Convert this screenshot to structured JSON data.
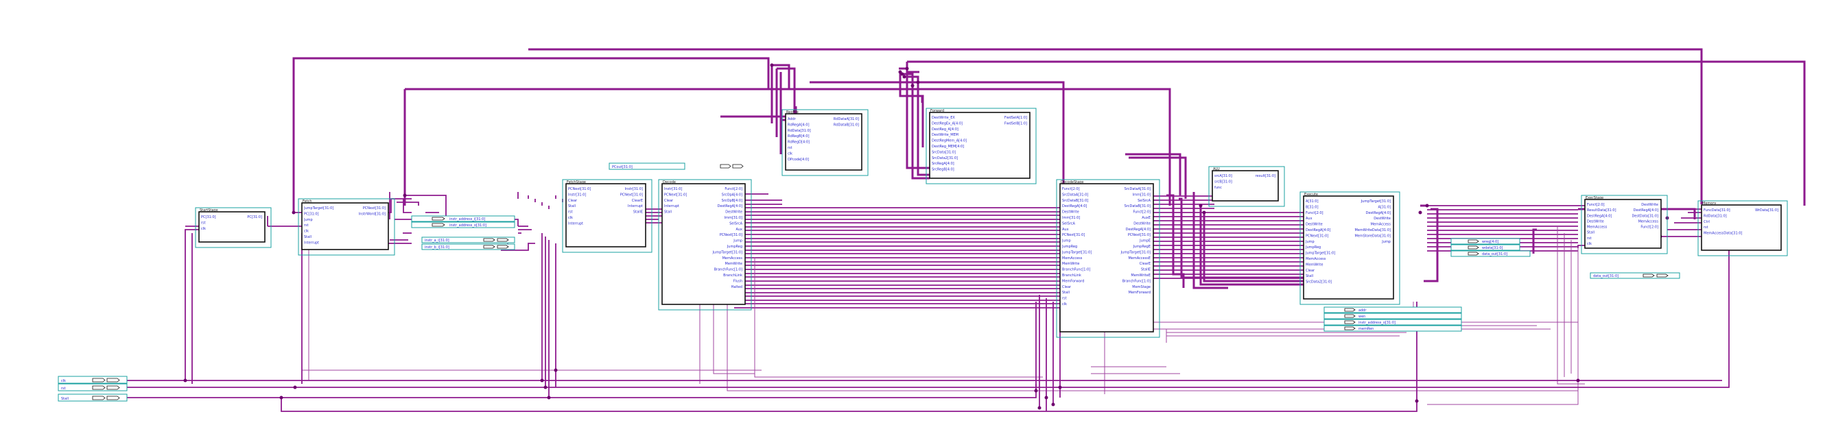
{
  "colors": {
    "wire": "#8e1a8e",
    "box_frame": "#1aa0a0",
    "port_text": "#2a2ad0"
  },
  "modules": [
    {
      "id": "start",
      "title": "StartStage",
      "inputs": [
        "PC[31:0]",
        "rst",
        "clk"
      ],
      "outputs": [
        "PC[31:0]"
      ]
    },
    {
      "id": "fetch",
      "title": "Fetch",
      "inputs": [
        "JumpTarget[31:0]",
        "PC[31:0]",
        "Jump",
        "rst",
        "clk",
        "Stall",
        "Interrupt"
      ],
      "outputs": [
        "PCNext[31:0]",
        "InstrWord[31:0]"
      ]
    },
    {
      "id": "fetchstage",
      "title": "FetchStage",
      "inputs": [
        "PCNext[31:0]",
        "Instr[31:0]",
        "Clear",
        "Stall",
        "rst",
        "clk",
        "Interrupt"
      ],
      "outputs": [
        "Instr[31:0]",
        "PCNext[31:0]",
        "ClearE",
        "Interrupt",
        "StallE"
      ]
    },
    {
      "id": "decode",
      "title": "Decode",
      "inputs": [
        "Instr[31:0]",
        "PCNext[31:0]",
        "Clear",
        "Interrupt",
        "Stall"
      ],
      "outputs": [
        "Funct[2:0]",
        "SrcOpA[4:0]",
        "SrcOpB[4:0]",
        "DestRegA[4:0]",
        "DestWrite",
        "Imm[31:0]",
        "SelSrcA",
        "Aux",
        "PCNext[31:0]",
        "Jump",
        "JumpReg",
        "JumpTarget[31:0]",
        "MemAccess",
        "MemWrite",
        "BranchFunc[1:0]",
        "BranchLink",
        "Flush",
        "Halted"
      ]
    },
    {
      "id": "regfile",
      "title": "RegFile",
      "inputs": [
        "Addr",
        "RdRegA[4:0]",
        "RdData[31:0]",
        "RdRegB[4:0]",
        "RdRegD[4:0]",
        "rst",
        "clk",
        "OPcode[4:0]"
      ],
      "outputs": [
        "RdDataA[31:0]",
        "RdDataB[31:0]"
      ]
    },
    {
      "id": "forward",
      "title": "Forward",
      "inputs": [
        "DestWrite_EX",
        "DestRegEx_A[4:0]",
        "DestReg_A[4:0]",
        "DestWrite_MEM",
        "DestRegMem_A[4:0]",
        "DestReg_MEM[4:0]",
        "SrcData[31:0]",
        "SrcData2[31:0]",
        "SrcRegA[4:0]",
        "SrcRegB[4:0]"
      ],
      "outputs": [
        "FwdSelA[1:0]",
        "FwdSelB[1:0]"
      ]
    },
    {
      "id": "decodestage",
      "title": "DecodeStage",
      "inputs": [
        "Funct[2:0]",
        "SrcDataA[31:0]",
        "SrcDataB[31:0]",
        "DestRegA[4:0]",
        "DestWrite",
        "Imm[31:0]",
        "SelSrcA",
        "Aux",
        "PCNext[31:0]",
        "Jump",
        "JumpReg",
        "JumpTarget[31:0]",
        "MemAccess",
        "MemWrite",
        "BranchFunc[1:0]",
        "BranchLink",
        "MemForward",
        "Clear",
        "Stall",
        "rst",
        "clk"
      ],
      "outputs": [
        "SrcDataA[31:0]",
        "Imm[31:0]",
        "SelSrcA",
        "SrcDataB[31:0]",
        "Funct[2:0]",
        "AuxE",
        "DestWrite",
        "DestRegA[4:0]",
        "PCNext[31:0]",
        "JumpE",
        "JumpRegE",
        "JumpTarget[31:0]",
        "MemAccessE",
        "ClearE",
        "StallE",
        "MemWriteE",
        "BranchFunc[1:0]",
        "MemStage",
        "MemForward"
      ]
    },
    {
      "id": "alu",
      "title": "ALU",
      "inputs": [
        "srcA[31:0]",
        "srcB[31:0]",
        "func"
      ],
      "outputs": [
        "result[31:0]"
      ]
    },
    {
      "id": "execute",
      "title": "Execute",
      "inputs": [
        "A[31:0]",
        "B[31:0]",
        "Funct[2:0]",
        "Aux",
        "DestWrite",
        "DestRegA[4:0]",
        "PCNext[31:0]",
        "Jump",
        "JumpReg",
        "JumpTarget[31:0]",
        "MemAccess",
        "MemWrite",
        "Clear",
        "Stall",
        "SrcData2[31:0]"
      ],
      "outputs": [
        "JumpTarget[31:0]",
        "A[31:0]",
        "DestRegA[4:0]",
        "DestWrite",
        "MemAccess",
        "MemWriteData[31:0]",
        "MemStoreData[31:0]",
        "Jump"
      ]
    },
    {
      "id": "execstage",
      "title": "ExecStage",
      "inputs": [
        "Funct[2:0]",
        "ResultData[31:0]",
        "DestRegA[4:0]",
        "DestWrite",
        "MemAccess",
        "Stall",
        "rst",
        "clk"
      ],
      "outputs": [
        "DestWrite",
        "DestRegA[4:0]",
        "DestData[31:0]",
        "MemAccess",
        "Funct[2:0]"
      ]
    },
    {
      "id": "memory",
      "title": "Memory",
      "inputs": [
        "FuncData[31:0]",
        "RdData[31:0]",
        "Ctrl",
        "rst",
        "MemAccessData[31:0]"
      ],
      "outputs": [
        "WrData[31:0]"
      ]
    }
  ],
  "inputs_left": [
    "clk",
    "rst",
    "Stall"
  ],
  "io_small": [
    {
      "id": "pcout",
      "label": "PCout[31:0]"
    },
    {
      "id": "instr_addr",
      "label": "instr_address_i[31:0]"
    },
    {
      "id": "instr_data",
      "label": "instr_address_o[31:0]"
    },
    {
      "id": "instr_a",
      "label": "instr_a_i[31:0]"
    },
    {
      "id": "instr_b",
      "label": "instr_b_i[31:0]"
    },
    {
      "id": "wreg",
      "label": "wreg[4:0]"
    },
    {
      "id": "wdata",
      "label": "wdata[31:0]"
    },
    {
      "id": "mem_ctrl",
      "label": "addr"
    },
    {
      "id": "mem_wr",
      "label": "wen"
    },
    {
      "id": "mem_size",
      "label": "data_out[31:0]"
    },
    {
      "id": "dout",
      "label": "data_out[31:0]"
    },
    {
      "id": "mem_ren",
      "label": "memRen"
    }
  ]
}
